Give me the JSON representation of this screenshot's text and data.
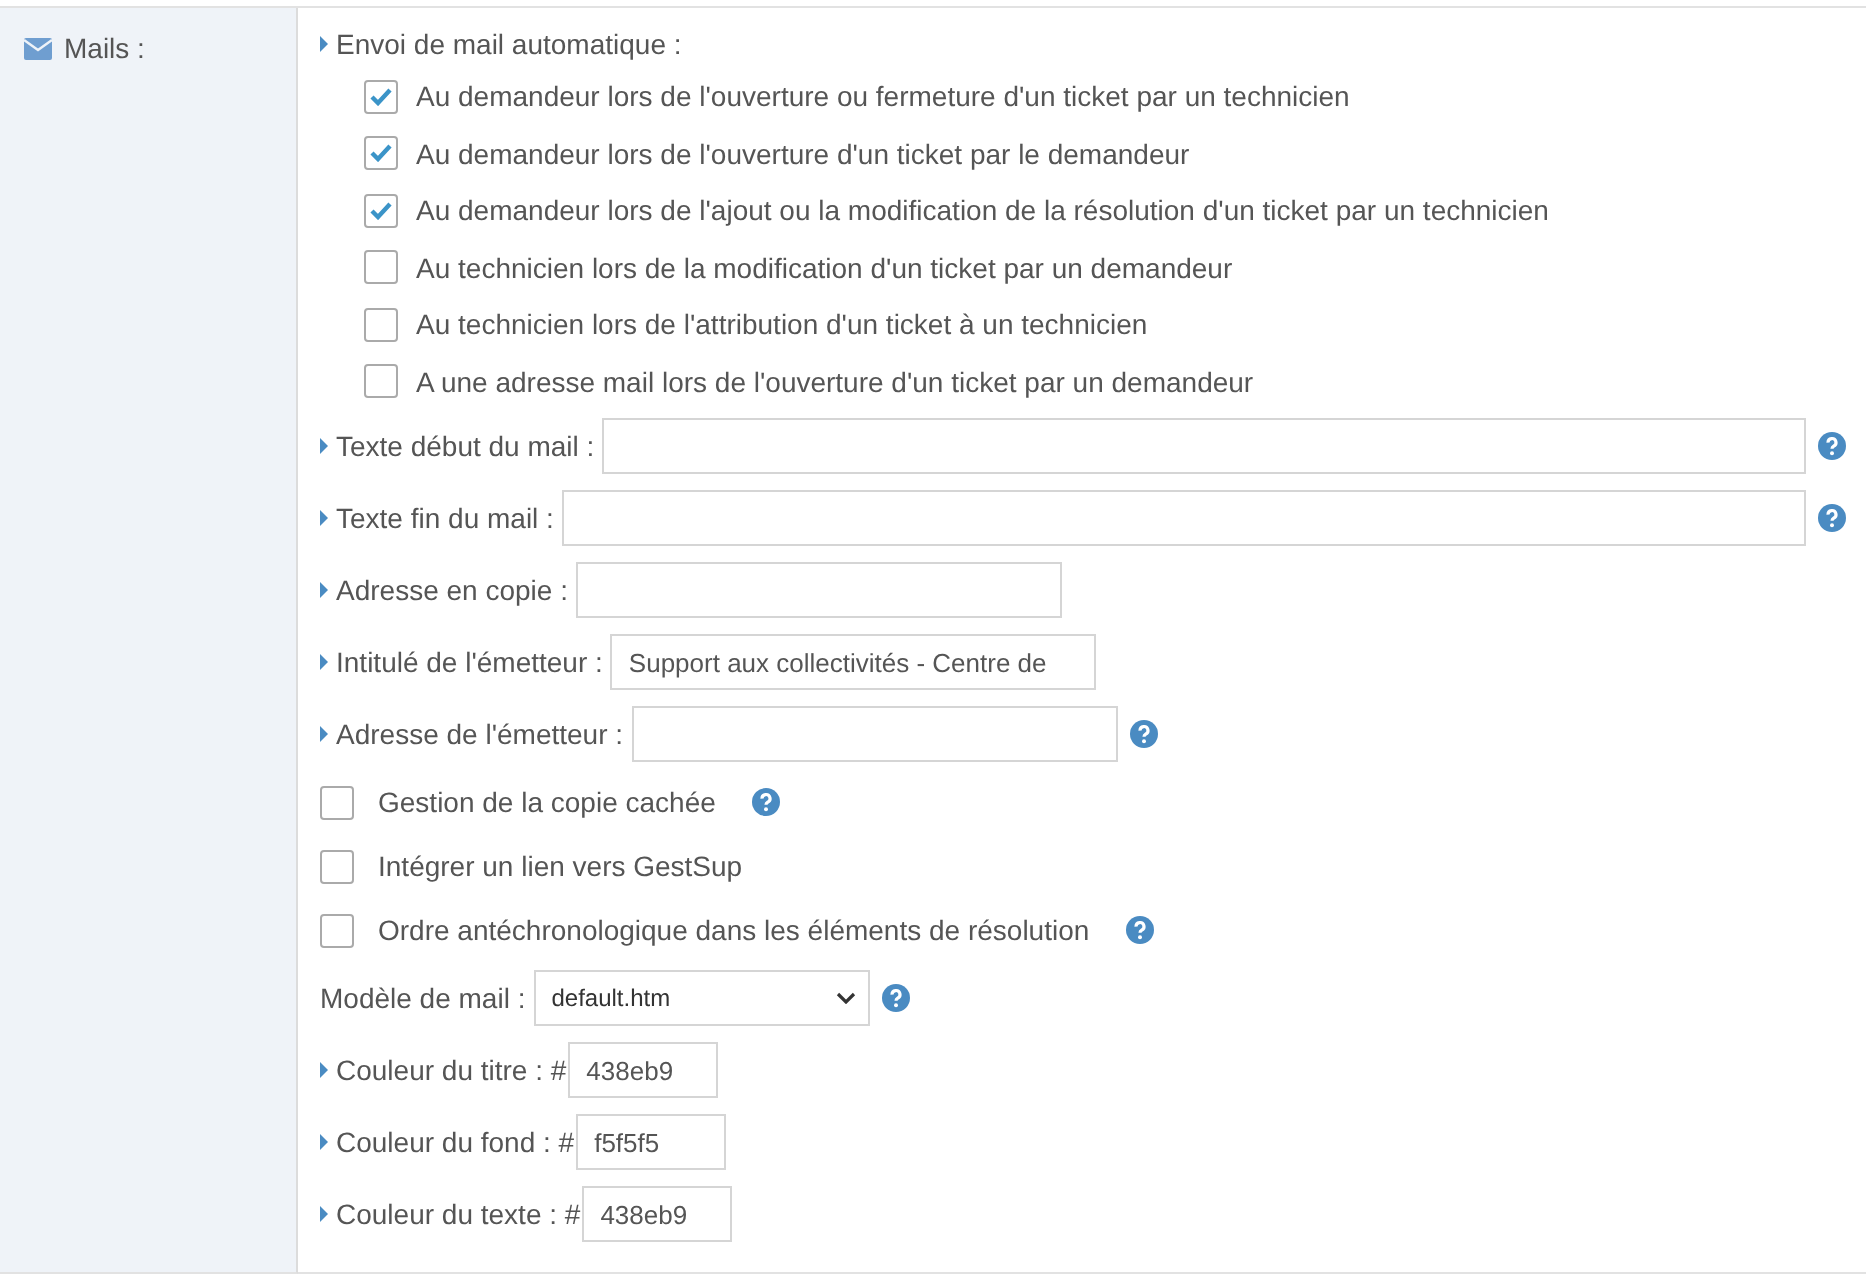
{
  "section": {
    "label": "Mails :"
  },
  "auto_mail": {
    "label": "Envoi de mail automatique :",
    "options": [
      {
        "label": "Au demandeur lors de l'ouverture ou fermeture d'un ticket par un technicien",
        "checked": true
      },
      {
        "label": "Au demandeur lors de l'ouverture d'un ticket par le demandeur",
        "checked": true
      },
      {
        "label": "Au demandeur lors de l'ajout ou la modification de la résolution d'un ticket par un technicien",
        "checked": true
      },
      {
        "label": "Au technicien lors de la modification d'un ticket par un demandeur",
        "checked": false
      },
      {
        "label": "Au technicien lors de l'attribution d'un ticket à un technicien",
        "checked": false
      },
      {
        "label": "A une adresse mail lors de l'ouverture d'un ticket par un demandeur",
        "checked": false
      }
    ]
  },
  "settings": [
    {
      "kind": "wide",
      "label": "Texte début du mail :",
      "help": true
    },
    {
      "kind": "wide",
      "label": "Texte fin du mail :",
      "help": true
    },
    {
      "kind": "text",
      "label": "Adresse en copie :",
      "help": false
    },
    {
      "kind": "text",
      "label": "Intitulé de l'émetteur :",
      "value": "Support aux collectivités - Centre de",
      "help": false
    },
    {
      "kind": "text",
      "label": "Adresse de l'émetteur :",
      "help": true
    },
    {
      "kind": "checkbox",
      "label": "Gestion de la copie cachée",
      "checked": false,
      "help": true
    },
    {
      "kind": "checkbox",
      "label": "Intégrer un lien vers GestSup",
      "checked": false,
      "help": false
    },
    {
      "kind": "checkbox",
      "label": "Ordre antéchronologique dans les éléments de résolution",
      "checked": false,
      "help": true
    },
    {
      "kind": "select",
      "label": "Modèle de mail :",
      "value": "default.htm",
      "help": true
    },
    {
      "kind": "color",
      "label": "Couleur du titre : #",
      "value": "438eb9",
      "help": false
    },
    {
      "kind": "color",
      "label": "Couleur du fond : #",
      "value": "f5f5f5",
      "help": false
    },
    {
      "kind": "color",
      "label": "Couleur du texte : #",
      "value": "438eb9",
      "help": false
    }
  ]
}
